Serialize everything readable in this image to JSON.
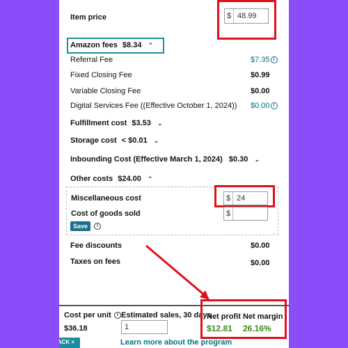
{
  "item_price": {
    "label": "Item price",
    "currency": "$",
    "value": "48.99"
  },
  "amazon_fees": {
    "label": "Amazon fees",
    "total": "$8.34",
    "chevron": "^"
  },
  "fees": [
    {
      "label": "Referral Fee",
      "value": "$7.35"
    },
    {
      "label": "Fixed Closing Fee",
      "value": "$0.99"
    },
    {
      "label": "Variable Closing Fee",
      "value": "$0.00"
    },
    {
      "label": "Digital Services Fee ((Effective October 1, 2024))",
      "value": "$0.00"
    }
  ],
  "fulfillment": {
    "label": "Fulfillment cost",
    "value": "$3.53"
  },
  "storage": {
    "label": "Storage cost",
    "value": "< $0.01"
  },
  "inbounding": {
    "label": "Inbounding Cost (Effective March 1, 2024)",
    "value": "$0.30"
  },
  "other_costs": {
    "label": "Other costs",
    "value": "$24.00"
  },
  "misc": {
    "label": "Miscellaneous cost",
    "currency": "$",
    "value": "24"
  },
  "cogs": {
    "label": "Cost of goods sold",
    "currency": "$",
    "value": ""
  },
  "save_label": "Save",
  "fee_discounts": {
    "label": "Fee discounts",
    "value": "$0.00"
  },
  "taxes": {
    "label": "Taxes on fees",
    "value": "$0.00"
  },
  "footer": {
    "cost_per_unit_label": "Cost per unit",
    "cost_per_unit_value": "$36.18",
    "estimated_sales_label": "Estimated sales, 30 days",
    "estimated_sales_value": "1",
    "net_profit_label": "Net profit",
    "net_profit_value": "$12.81",
    "net_margin_label": "Net margin",
    "net_margin_value": "26.16%",
    "learn_more": "Learn more about the program",
    "back_label": "BACK ×"
  },
  "colors": {
    "background": "#8a4dfa",
    "highlight_red": "#e0101a",
    "highlight_teal": "#1d8fa0",
    "link": "#007185",
    "profit_green": "#3d8a1f"
  },
  "icons": [
    "info-icon",
    "chevron-up-icon",
    "chevron-down-icon",
    "close-icon"
  ]
}
